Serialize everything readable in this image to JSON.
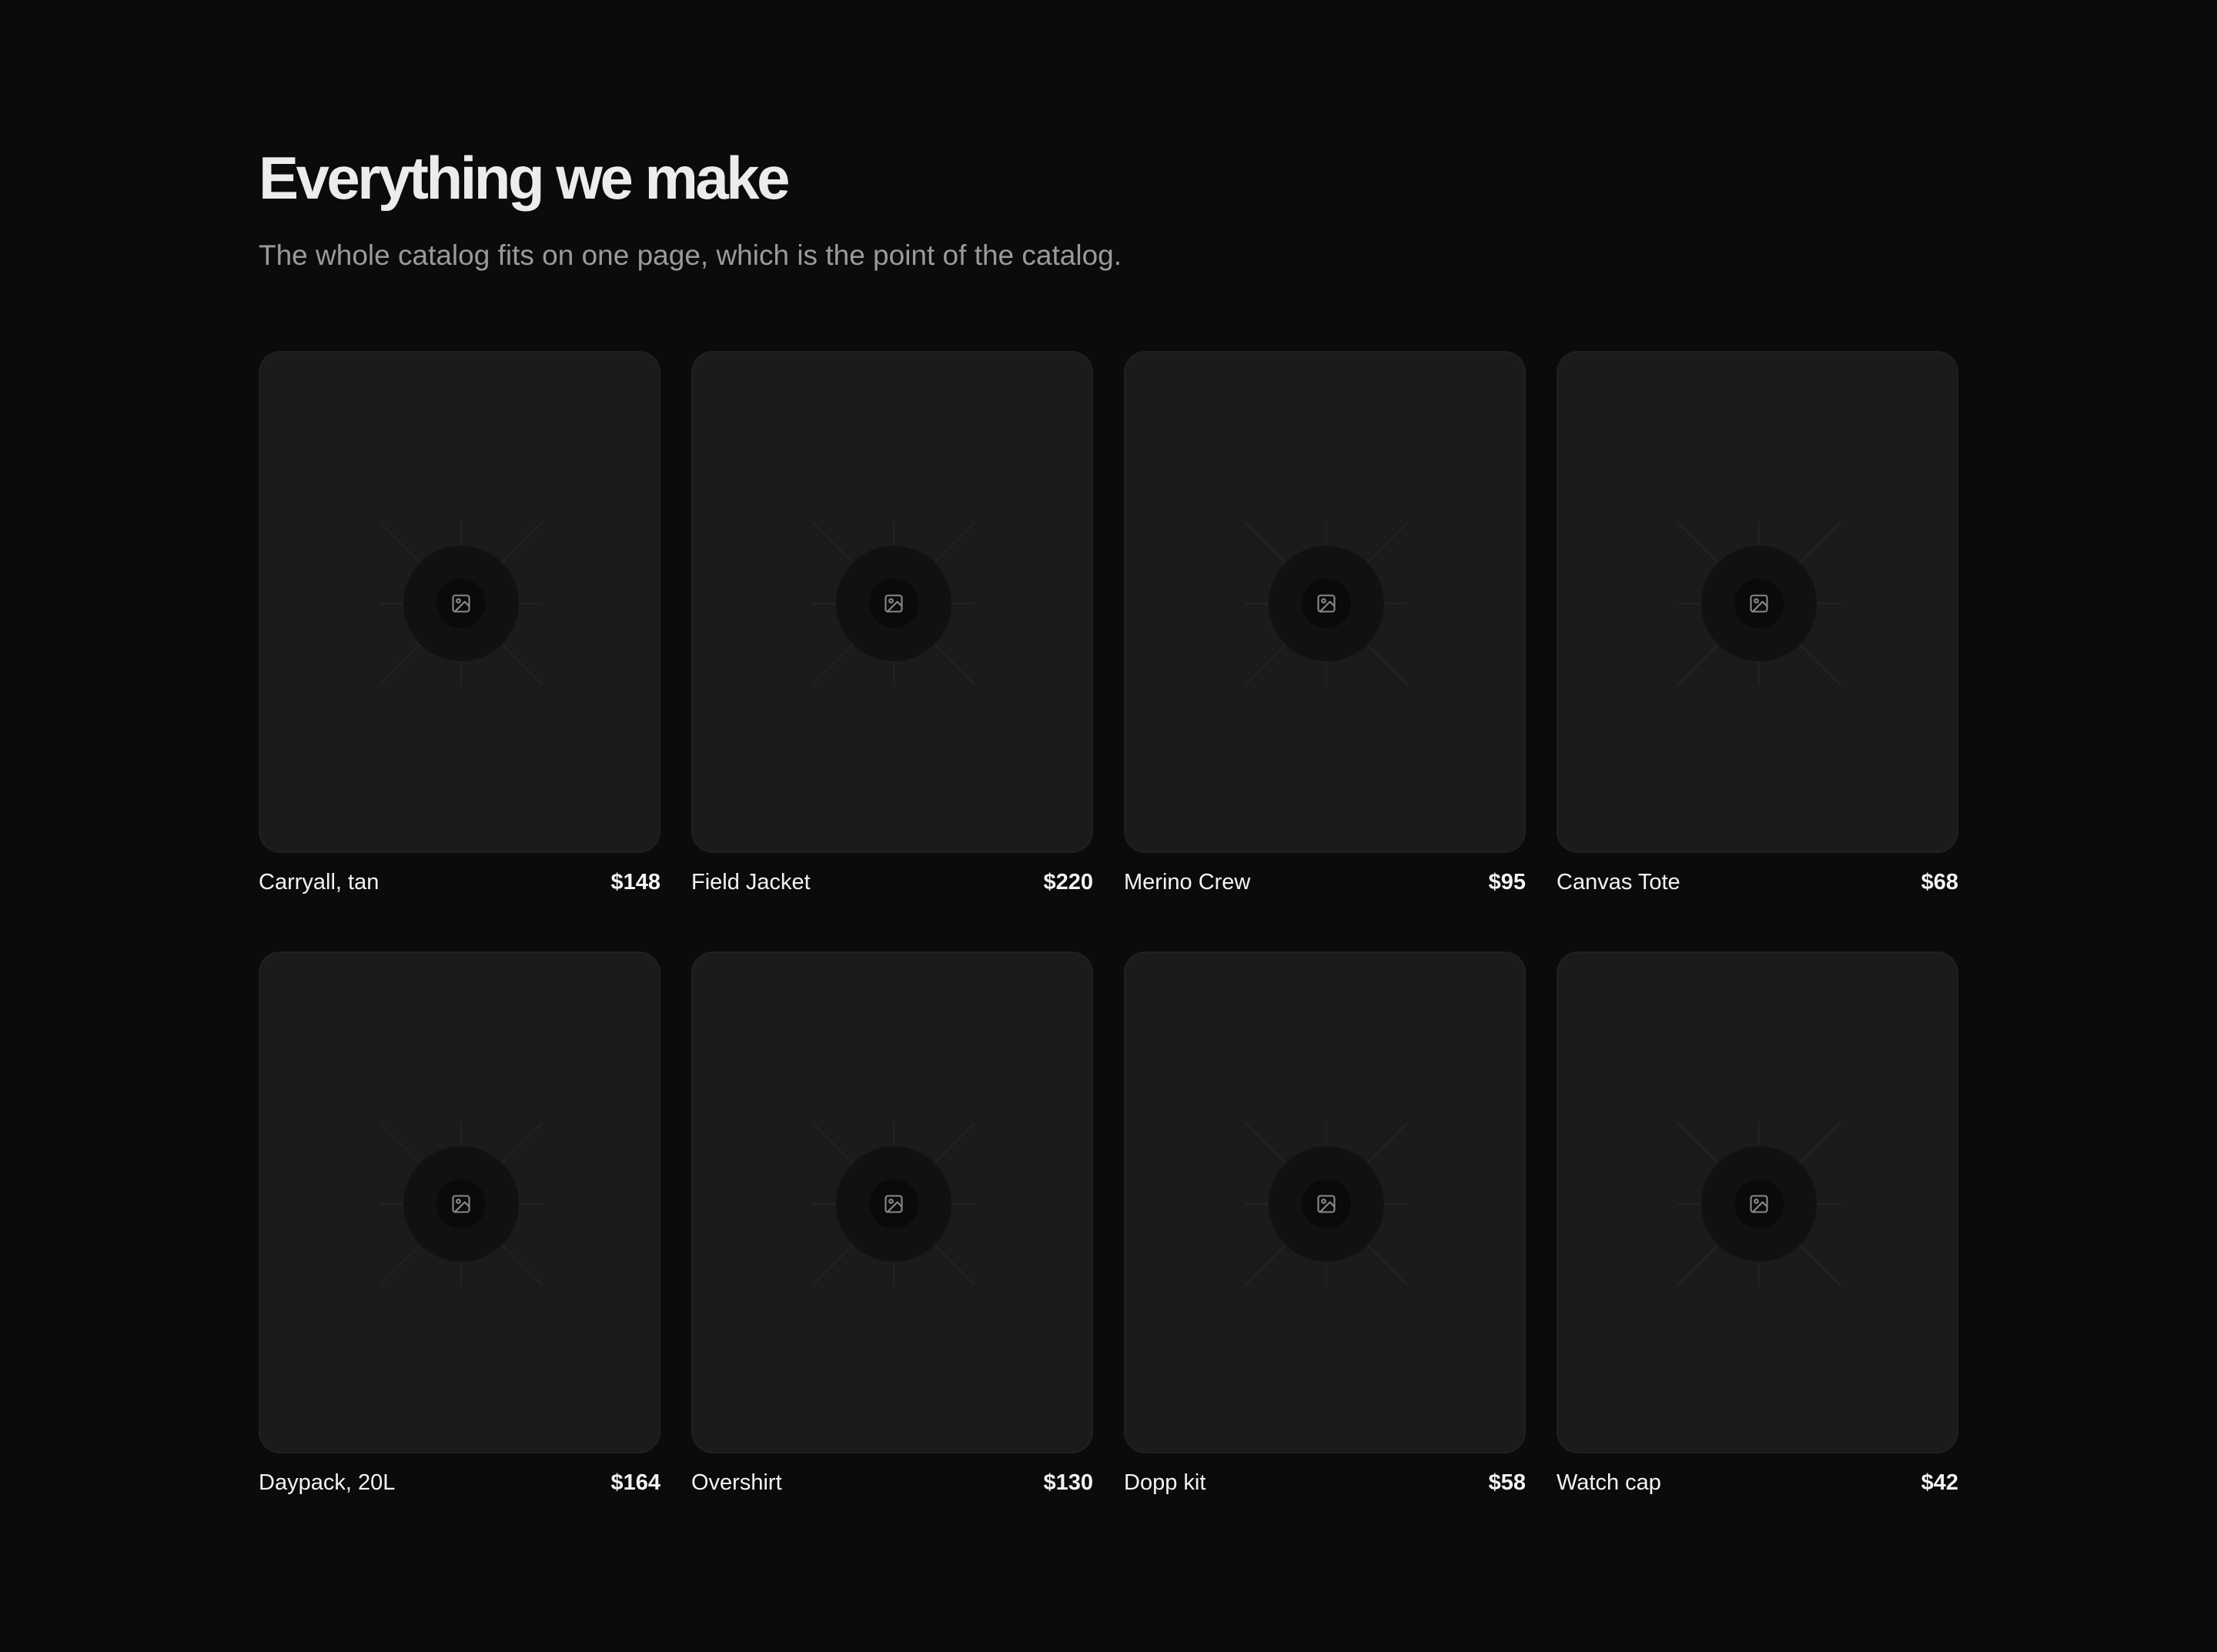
{
  "header": {
    "title": "Everything we make",
    "subtitle": "The whole catalog fits on one page, which is the point of the catalog."
  },
  "theme": {
    "background": "#0b0b0b",
    "card_background": "#1b1b1b",
    "text": "#f3f3f3",
    "muted_text": "#9a9a9a"
  },
  "products": [
    {
      "name": "Carryall, tan",
      "price": "$148",
      "image_icon": "image-placeholder-icon"
    },
    {
      "name": "Field Jacket",
      "price": "$220",
      "image_icon": "image-placeholder-icon"
    },
    {
      "name": "Merino Crew",
      "price": "$95",
      "image_icon": "image-placeholder-icon"
    },
    {
      "name": "Canvas Tote",
      "price": "$68",
      "image_icon": "image-placeholder-icon"
    },
    {
      "name": "Daypack, 20L",
      "price": "$164",
      "image_icon": "image-placeholder-icon"
    },
    {
      "name": "Overshirt",
      "price": "$130",
      "image_icon": "image-placeholder-icon"
    },
    {
      "name": "Dopp kit",
      "price": "$58",
      "image_icon": "image-placeholder-icon"
    },
    {
      "name": "Watch cap",
      "price": "$42",
      "image_icon": "image-placeholder-icon"
    }
  ]
}
